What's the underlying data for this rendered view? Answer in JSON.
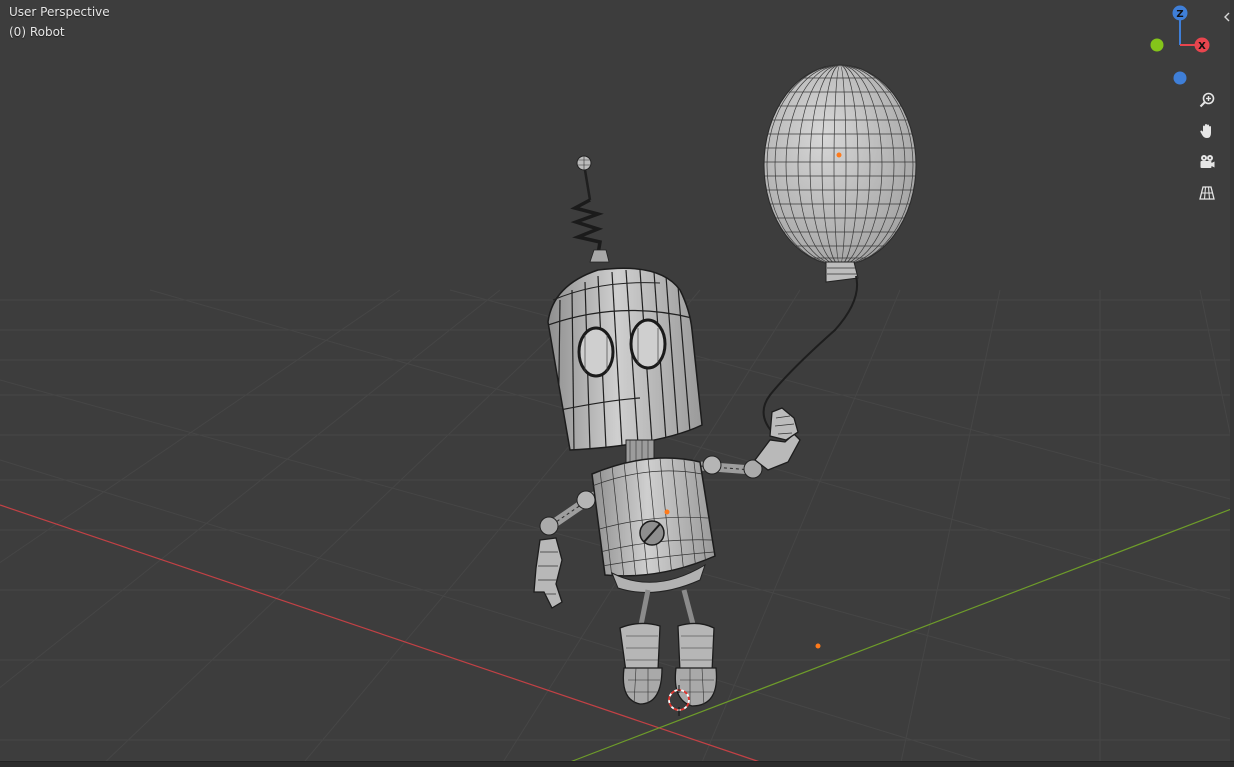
{
  "viewport": {
    "view_title": "User Perspective",
    "active_object": "(0) Robot"
  },
  "gizmo": {
    "axes": [
      {
        "name": "Z",
        "color": "#3f7fd8"
      },
      {
        "name": "X",
        "color": "#e8454e"
      },
      {
        "name": "Y",
        "color": "#84c41a"
      }
    ],
    "negative_axis_colors": {
      "y": "#84c41a",
      "z": "#3f7fd8"
    }
  },
  "navigation": {
    "buttons": [
      {
        "name": "zoom",
        "icon": "zoom-icon"
      },
      {
        "name": "pan",
        "icon": "hand-icon"
      },
      {
        "name": "camera",
        "icon": "camera-icon"
      },
      {
        "name": "perspective",
        "icon": "grid-icon"
      }
    ]
  },
  "scene": {
    "object": "Robot",
    "parts": [
      "balloon",
      "antenna",
      "head",
      "eyes",
      "neck",
      "body",
      "arms",
      "hands",
      "legs",
      "feet"
    ],
    "grid": true,
    "axis_colors": {
      "x": "#c24145",
      "y": "#6e9c2a"
    },
    "colors": {
      "background": "#3d3d3d",
      "grid_line": "#4a4a4a",
      "mesh": "#b9b9b9",
      "wire": "#2a2a2a",
      "origin": "#ff7a1a"
    }
  }
}
